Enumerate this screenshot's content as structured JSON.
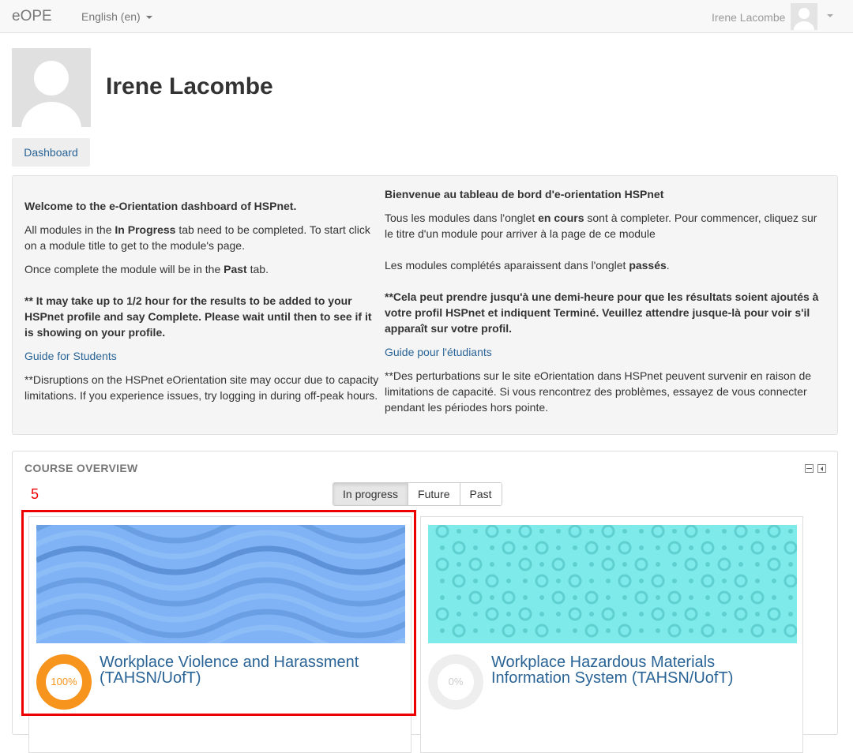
{
  "navbar": {
    "brand": "eOPE",
    "language": "English (en)",
    "user_name": "Irene Lacombe"
  },
  "profile": {
    "name": "Irene Lacombe",
    "dashboard_button": "Dashboard"
  },
  "welcome_en": {
    "heading": "Welcome to the e-Orientation dashboard of HSPnet.",
    "p1_a": "All modules in the ",
    "p1_b": "In Progress",
    "p1_c": " tab need to be completed. To start click on a module title to get to the module's page.",
    "p2_a": "Once complete the module will be in the ",
    "p2_b": "Past",
    "p2_c": " tab.",
    "p3": "** It may take up to 1/2 hour for the results to be added to your HSPnet profile and say Complete. Please wait until then to see if it is showing on your profile.",
    "guide_link": "Guide for Students",
    "p4": "**Disruptions on the HSPnet eOrientation site may occur due to capacity limitations. If you experience issues, try logging in during off-peak hours."
  },
  "welcome_fr": {
    "heading": "Bienvenue au tableau de bord d'e-orientation HSPnet",
    "p1_a": "Tous les modules dans l'onglet ",
    "p1_b": "en cours",
    "p1_c": " sont à completer. Pour commencer, cliquez sur le titre d'un module pour arriver à la page de ce module",
    "p2_a": "Les modules complétés aparaissent dans l'onglet ",
    "p2_b": "passés",
    "p2_c": ".",
    "p3": "**Cela peut prendre jusqu'à une demi-heure pour que les résultats soient ajoutés à votre profil HSPnet et indiquent Terminé. Veuillez attendre jusque-là pour voir s'il apparaît sur votre profil.",
    "guide_link": "Guide pour l'étudiants",
    "p4": "**Des perturbations sur le site eOrientation dans HSPnet peuvent survenir en raison de limitations de capacité. Si vous rencontrez des problèmes, essayez de vous connecter pendant les périodes hors pointe."
  },
  "course_overview": {
    "title": "COURSE OVERVIEW",
    "annotation_number": "5",
    "tabs": [
      "In progress",
      "Future",
      "Past"
    ],
    "active_tab": "In progress",
    "courses": [
      {
        "title": "Workplace Violence and Harassment (TAHSN/UofT)",
        "progress_label": "100%",
        "progress": 100,
        "progress_color": "#f7941d",
        "image_color": "#7fb3f5"
      },
      {
        "title": "Workplace Hazardous Materials Information System (TAHSN/UofT)",
        "progress_label": "0%",
        "progress": 0,
        "progress_color": "#eeeeee",
        "image_color": "#7eeaea"
      }
    ]
  },
  "icons": [
    "user-silhouette-icon",
    "caret-down-icon",
    "minimize-icon",
    "dock-icon"
  ]
}
